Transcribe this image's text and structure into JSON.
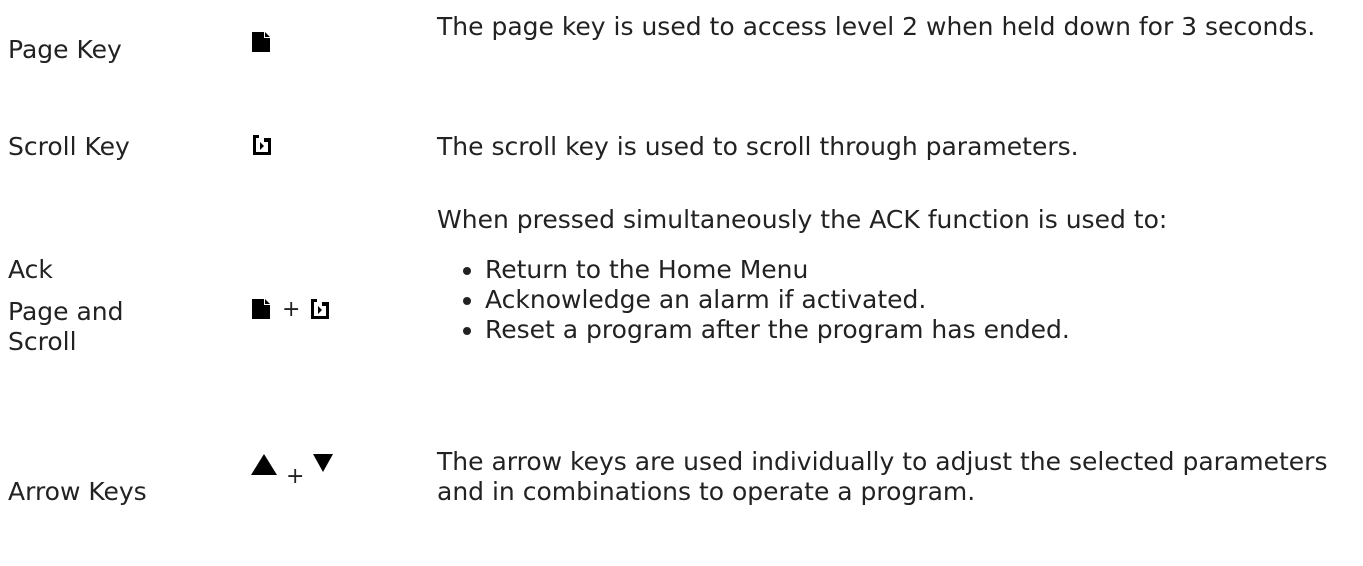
{
  "rows": [
    {
      "label": "Page Key",
      "description": "The page key is used to access level 2 when held down for 3 seconds."
    },
    {
      "label": "Scroll Key",
      "description": "The scroll key is used to scroll through parameters."
    },
    {
      "label_line1": "Ack",
      "label_line2": "Page and Scroll",
      "plus": "+",
      "description": "When pressed simultaneously the ACK function is used to:",
      "bullets": [
        "Return to the Home Menu",
        "Acknowledge an alarm if activated.",
        "Reset a program after the program has ended."
      ]
    },
    {
      "label": "Arrow Keys",
      "plus": "+",
      "description": "The arrow keys are used individually to adjust the selected parameters and in combinations to operate a program."
    }
  ],
  "icons": {
    "page": "page-key-icon",
    "scroll": "scroll-key-icon",
    "up": "arrow-up-icon",
    "down": "arrow-down-icon"
  },
  "colors": {
    "text": "#222222",
    "icon": "#000000"
  }
}
